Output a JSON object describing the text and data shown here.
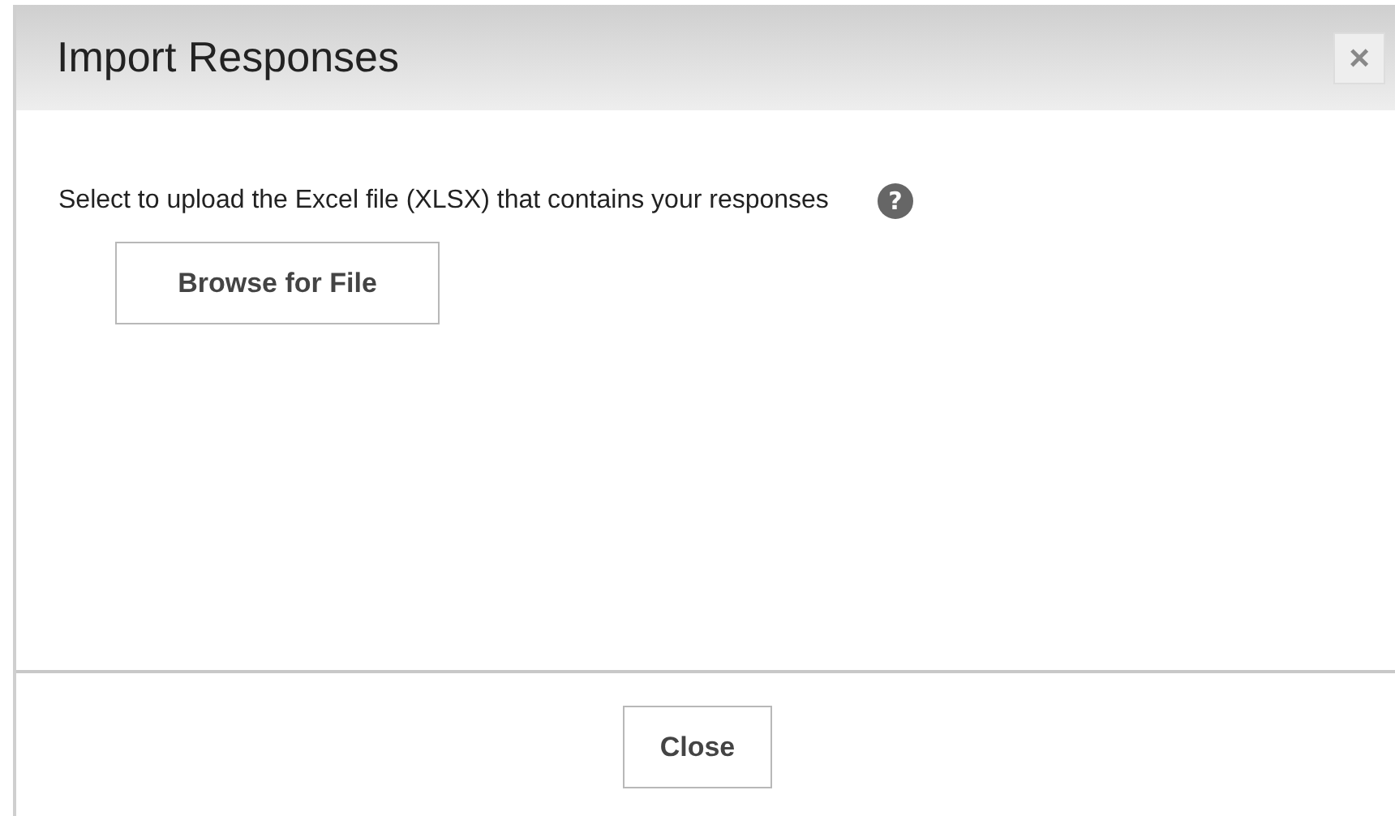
{
  "dialog": {
    "title": "Import Responses",
    "close_icon": "×",
    "instruction": "Select to upload the Excel file (XLSX) that contains your responses",
    "help_icon": "?",
    "browse_button": "Browse for File",
    "footer_button": "Close"
  }
}
